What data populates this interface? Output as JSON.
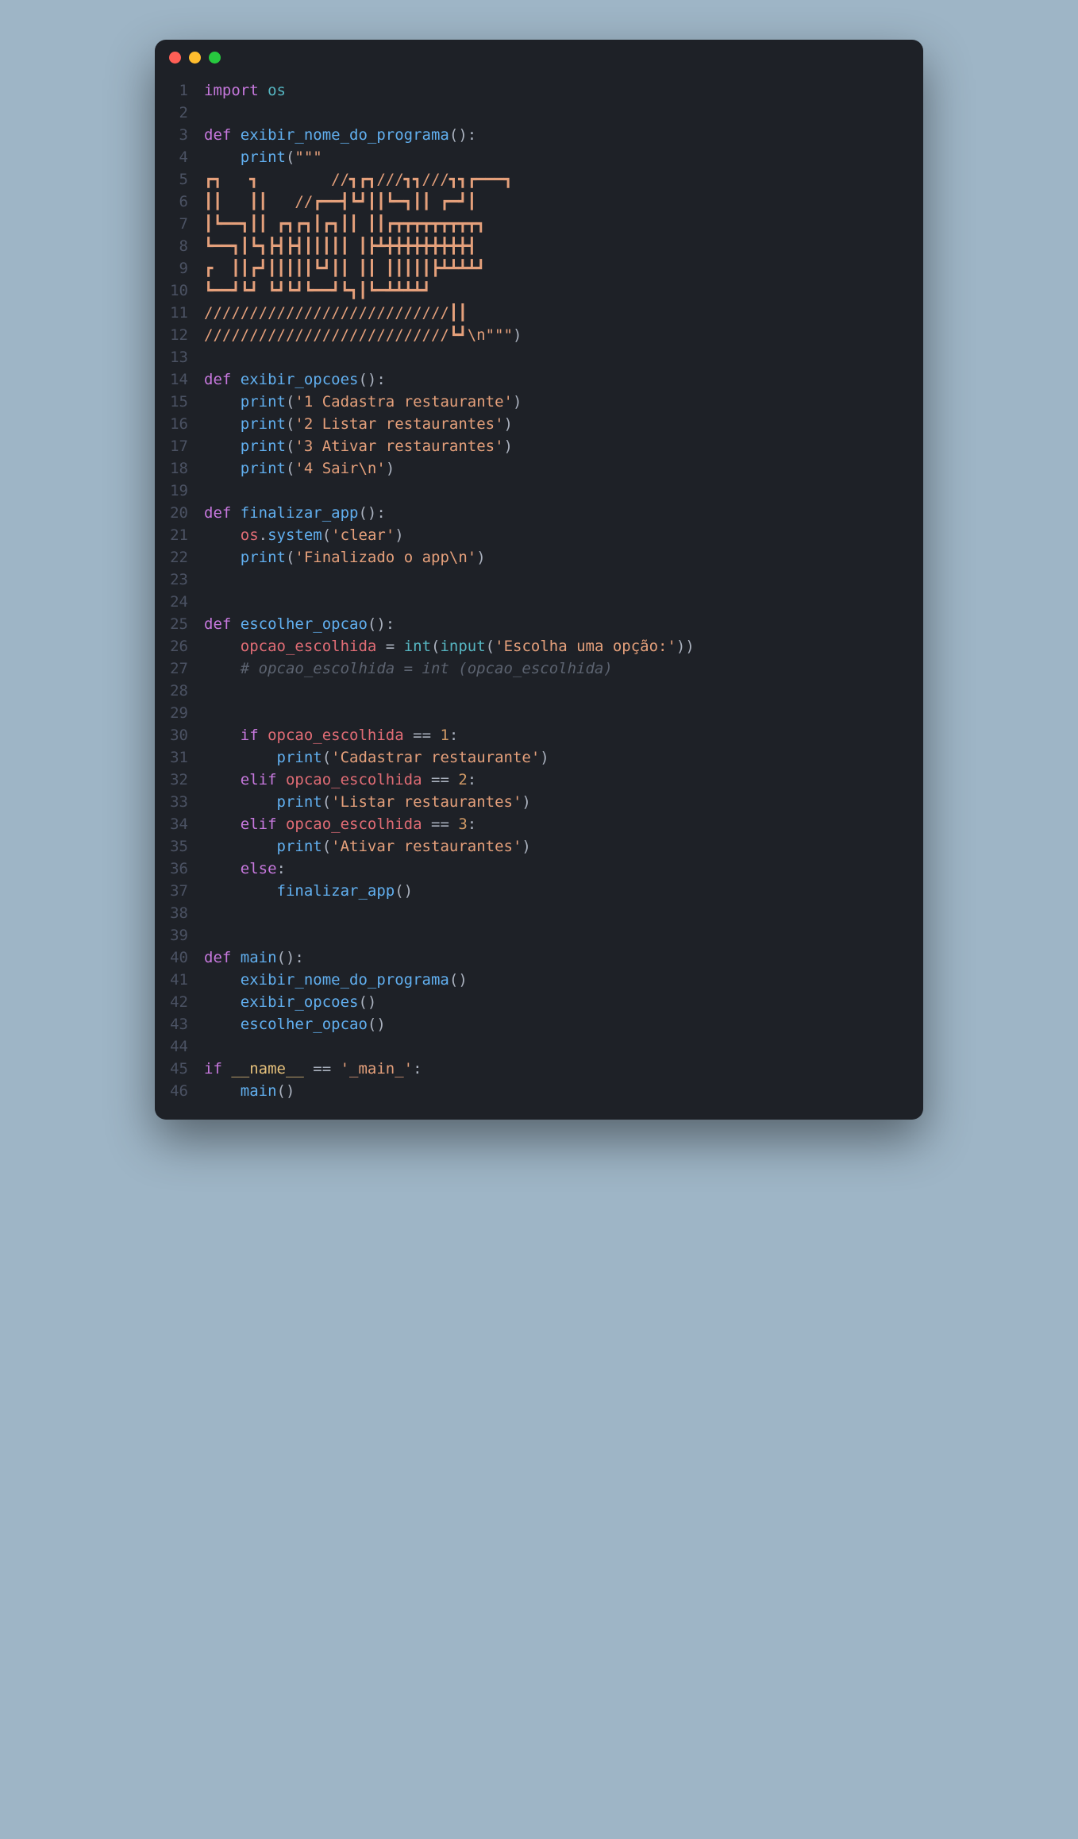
{
  "window": {
    "traffic_lights": [
      "close",
      "minimize",
      "zoom"
    ]
  },
  "code": {
    "lines": [
      {
        "n": 1,
        "tokens": [
          [
            "kw",
            "import "
          ],
          [
            "mod",
            "os"
          ]
        ]
      },
      {
        "n": 2,
        "tokens": []
      },
      {
        "n": 3,
        "tokens": [
          [
            "kw",
            "def "
          ],
          [
            "def",
            "exibir_nome_do_programa"
          ],
          [
            "punct",
            "():"
          ]
        ]
      },
      {
        "n": 4,
        "tokens": [
          [
            "op",
            "    "
          ],
          [
            "fn",
            "print"
          ],
          [
            "punct",
            "("
          ],
          [
            "str",
            "\"\"\""
          ]
        ]
      },
      {
        "n": 5,
        "tokens": [
          [
            "str",
            "┏┓   ┓        //┓┏┓///┓┓///┓┓┏━━━┓"
          ]
        ]
      },
      {
        "n": 6,
        "tokens": [
          [
            "str",
            "┃┃   ┃┃   //┏━━┫┗┛┃┃┗━┓┃┃ ┏━┛┃"
          ]
        ]
      },
      {
        "n": 7,
        "tokens": [
          [
            "str",
            "┃┗━━┓┃┃ ┏┓┏┓┃┏┓┃┃ ┃┃┏┳┳┳┳┳┳┳┳┳┓"
          ]
        ]
      },
      {
        "n": 8,
        "tokens": [
          [
            "str",
            "┗━━┓┃┗┓┣┫┣┫┃┃┃┃┃ ┃┣┻╋╋╋╋╋╋╋╋╋┫"
          ]
        ]
      },
      {
        "n": 9,
        "tokens": [
          [
            "str",
            "┏  ┃┃┏┛┃┃┃┃┃┗┛┃┃ ┃┃ ┃┃┃┃┃┣┻┻┻┻┛"
          ]
        ]
      },
      {
        "n": 10,
        "tokens": [
          [
            "str",
            "┗━━┛┗┛ ┗┛┗┛┗━━┛┗┓┃┗━┻┻┻┻┛"
          ]
        ]
      },
      {
        "n": 11,
        "tokens": [
          [
            "str",
            "///////////////////////////┃┃"
          ]
        ]
      },
      {
        "n": 12,
        "tokens": [
          [
            "str",
            "///////////////////////////┗┛\\n\"\"\""
          ],
          [
            "punct",
            ")"
          ]
        ]
      },
      {
        "n": 13,
        "tokens": []
      },
      {
        "n": 14,
        "tokens": [
          [
            "kw",
            "def "
          ],
          [
            "def",
            "exibir_opcoes"
          ],
          [
            "punct",
            "():"
          ]
        ]
      },
      {
        "n": 15,
        "tokens": [
          [
            "op",
            "    "
          ],
          [
            "fn",
            "print"
          ],
          [
            "punct",
            "("
          ],
          [
            "str",
            "'1 Cadastra restaurante'"
          ],
          [
            "punct",
            ")"
          ]
        ]
      },
      {
        "n": 16,
        "tokens": [
          [
            "op",
            "    "
          ],
          [
            "fn",
            "print"
          ],
          [
            "punct",
            "("
          ],
          [
            "str",
            "'2 Listar restaurantes'"
          ],
          [
            "punct",
            ")"
          ]
        ]
      },
      {
        "n": 17,
        "tokens": [
          [
            "op",
            "    "
          ],
          [
            "fn",
            "print"
          ],
          [
            "punct",
            "("
          ],
          [
            "str",
            "'3 Ativar restaurantes'"
          ],
          [
            "punct",
            ")"
          ]
        ]
      },
      {
        "n": 18,
        "tokens": [
          [
            "op",
            "    "
          ],
          [
            "fn",
            "print"
          ],
          [
            "punct",
            "("
          ],
          [
            "str",
            "'4 Sair\\n'"
          ],
          [
            "punct",
            ")"
          ]
        ]
      },
      {
        "n": 19,
        "tokens": []
      },
      {
        "n": 20,
        "tokens": [
          [
            "kw",
            "def "
          ],
          [
            "def",
            "finalizar_app"
          ],
          [
            "punct",
            "():"
          ]
        ]
      },
      {
        "n": 21,
        "tokens": [
          [
            "op",
            "    "
          ],
          [
            "var",
            "os"
          ],
          [
            "punct",
            "."
          ],
          [
            "fn",
            "system"
          ],
          [
            "punct",
            "("
          ],
          [
            "str",
            "'clear'"
          ],
          [
            "punct",
            ")"
          ]
        ]
      },
      {
        "n": 22,
        "tokens": [
          [
            "op",
            "    "
          ],
          [
            "fn",
            "print"
          ],
          [
            "punct",
            "("
          ],
          [
            "str",
            "'Finalizado o app\\n'"
          ],
          [
            "punct",
            ")"
          ]
        ]
      },
      {
        "n": 23,
        "tokens": []
      },
      {
        "n": 24,
        "tokens": []
      },
      {
        "n": 25,
        "tokens": [
          [
            "kw",
            "def "
          ],
          [
            "def",
            "escolher_opcao"
          ],
          [
            "punct",
            "():"
          ]
        ]
      },
      {
        "n": 26,
        "tokens": [
          [
            "op",
            "    "
          ],
          [
            "var",
            "opcao_escolhida"
          ],
          [
            "op",
            " = "
          ],
          [
            "builtin",
            "int"
          ],
          [
            "punct",
            "("
          ],
          [
            "builtin",
            "input"
          ],
          [
            "punct",
            "("
          ],
          [
            "str",
            "'Escolha uma opção:'"
          ],
          [
            "punct",
            "))"
          ]
        ]
      },
      {
        "n": 27,
        "tokens": [
          [
            "op",
            "    "
          ],
          [
            "cmt",
            "# opcao_escolhida = int (opcao_escolhida)"
          ]
        ]
      },
      {
        "n": 28,
        "tokens": []
      },
      {
        "n": 29,
        "tokens": []
      },
      {
        "n": 30,
        "tokens": [
          [
            "op",
            "    "
          ],
          [
            "kw",
            "if "
          ],
          [
            "var",
            "opcao_escolhida"
          ],
          [
            "op",
            " == "
          ],
          [
            "num",
            "1"
          ],
          [
            "punct",
            ":"
          ]
        ]
      },
      {
        "n": 31,
        "tokens": [
          [
            "op",
            "        "
          ],
          [
            "fn",
            "print"
          ],
          [
            "punct",
            "("
          ],
          [
            "str",
            "'Cadastrar restaurante'"
          ],
          [
            "punct",
            ")"
          ]
        ]
      },
      {
        "n": 32,
        "tokens": [
          [
            "op",
            "    "
          ],
          [
            "kw",
            "elif "
          ],
          [
            "var",
            "opcao_escolhida"
          ],
          [
            "op",
            " == "
          ],
          [
            "num",
            "2"
          ],
          [
            "punct",
            ":"
          ]
        ]
      },
      {
        "n": 33,
        "tokens": [
          [
            "op",
            "        "
          ],
          [
            "fn",
            "print"
          ],
          [
            "punct",
            "("
          ],
          [
            "str",
            "'Listar restaurantes'"
          ],
          [
            "punct",
            ")"
          ]
        ]
      },
      {
        "n": 34,
        "tokens": [
          [
            "op",
            "    "
          ],
          [
            "kw",
            "elif "
          ],
          [
            "var",
            "opcao_escolhida"
          ],
          [
            "op",
            " == "
          ],
          [
            "num",
            "3"
          ],
          [
            "punct",
            ":"
          ]
        ]
      },
      {
        "n": 35,
        "tokens": [
          [
            "op",
            "        "
          ],
          [
            "fn",
            "print"
          ],
          [
            "punct",
            "("
          ],
          [
            "str",
            "'Ativar restaurantes'"
          ],
          [
            "punct",
            ")"
          ]
        ]
      },
      {
        "n": 36,
        "tokens": [
          [
            "op",
            "    "
          ],
          [
            "kw",
            "else"
          ],
          [
            "punct",
            ":"
          ]
        ]
      },
      {
        "n": 37,
        "tokens": [
          [
            "op",
            "        "
          ],
          [
            "fn",
            "finalizar_app"
          ],
          [
            "punct",
            "()"
          ]
        ]
      },
      {
        "n": 38,
        "tokens": []
      },
      {
        "n": 39,
        "tokens": []
      },
      {
        "n": 40,
        "tokens": [
          [
            "kw",
            "def "
          ],
          [
            "def",
            "main"
          ],
          [
            "punct",
            "():"
          ]
        ]
      },
      {
        "n": 41,
        "tokens": [
          [
            "op",
            "    "
          ],
          [
            "fn",
            "exibir_nome_do_programa"
          ],
          [
            "punct",
            "()"
          ]
        ]
      },
      {
        "n": 42,
        "tokens": [
          [
            "op",
            "    "
          ],
          [
            "fn",
            "exibir_opcoes"
          ],
          [
            "punct",
            "()"
          ]
        ]
      },
      {
        "n": 43,
        "tokens": [
          [
            "op",
            "    "
          ],
          [
            "fn",
            "escolher_opcao"
          ],
          [
            "punct",
            "()"
          ]
        ]
      },
      {
        "n": 44,
        "tokens": []
      },
      {
        "n": 45,
        "tokens": [
          [
            "kw",
            "if "
          ],
          [
            "dunder",
            "__name__"
          ],
          [
            "op",
            " == "
          ],
          [
            "str",
            "'_main_'"
          ],
          [
            "punct",
            ":"
          ]
        ]
      },
      {
        "n": 46,
        "tokens": [
          [
            "op",
            "    "
          ],
          [
            "fn",
            "main"
          ],
          [
            "punct",
            "()"
          ]
        ]
      }
    ]
  }
}
